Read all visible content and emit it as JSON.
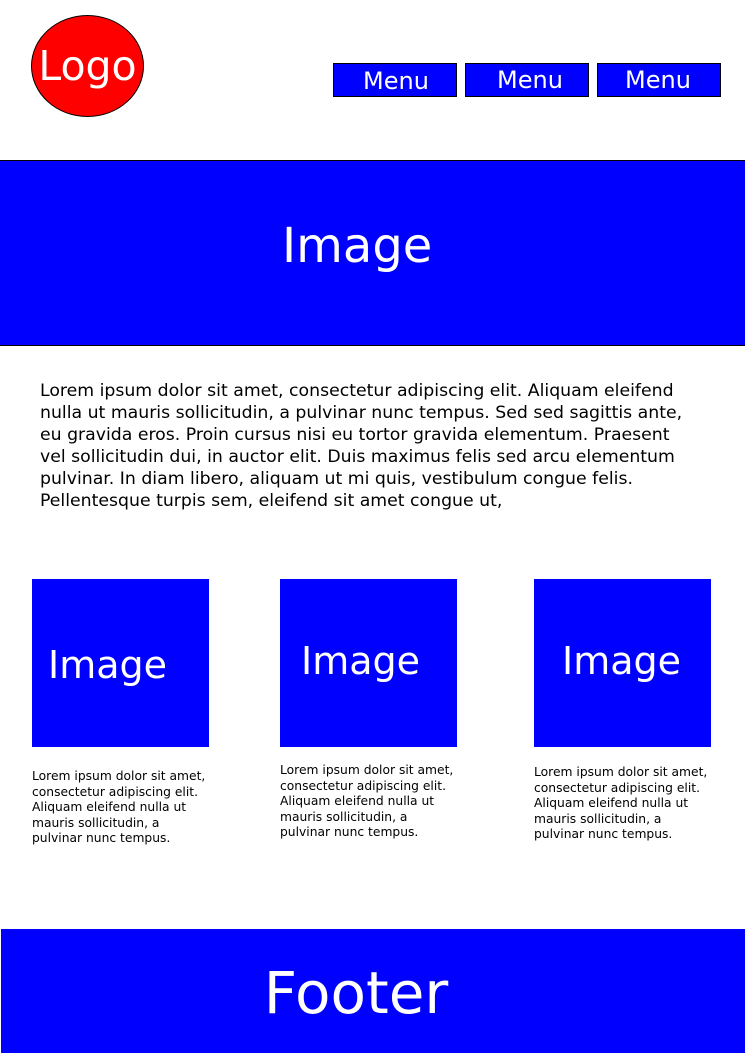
{
  "header": {
    "logo_label": "Logo",
    "menu": [
      "Menu",
      "Menu",
      "Menu"
    ]
  },
  "hero": {
    "label": "Image"
  },
  "intro": {
    "text": "Lorem ipsum dolor sit amet, consectetur adipiscing elit. Aliquam eleifend nulla ut mauris sollicitudin, a pulvinar nunc tempus. Sed sed sagittis ante, eu gravida eros. Proin cursus nisi eu tortor gravida elementum. Praesent vel sollicitudin dui, in auctor elit. Duis maximus felis sed arcu elementum pulvinar. In diam libero, aliquam ut mi quis, vestibulum congue felis. Pellentesque turpis sem, eleifend sit amet congue ut,"
  },
  "cards": [
    {
      "label": "Image",
      "text": "Lorem ipsum dolor sit amet, consectetur adipiscing elit. Aliquam eleifend nulla ut mauris sollicitudin, a pulvinar nunc tempus."
    },
    {
      "label": "Image",
      "text": "Lorem ipsum dolor sit amet, consectetur adipiscing elit. Aliquam eleifend nulla ut mauris sollicitudin, a pulvinar nunc tempus."
    },
    {
      "label": "Image",
      "text": "Lorem ipsum dolor sit amet, consectetur adipiscing elit. Aliquam eleifend nulla ut mauris sollicitudin, a pulvinar nunc tempus."
    }
  ],
  "footer": {
    "label": "Footer"
  },
  "colors": {
    "logo": "#ff0000",
    "block": "#0000ff",
    "block_text": "#ffffff",
    "body_text": "#000000",
    "outline": "#000000"
  }
}
